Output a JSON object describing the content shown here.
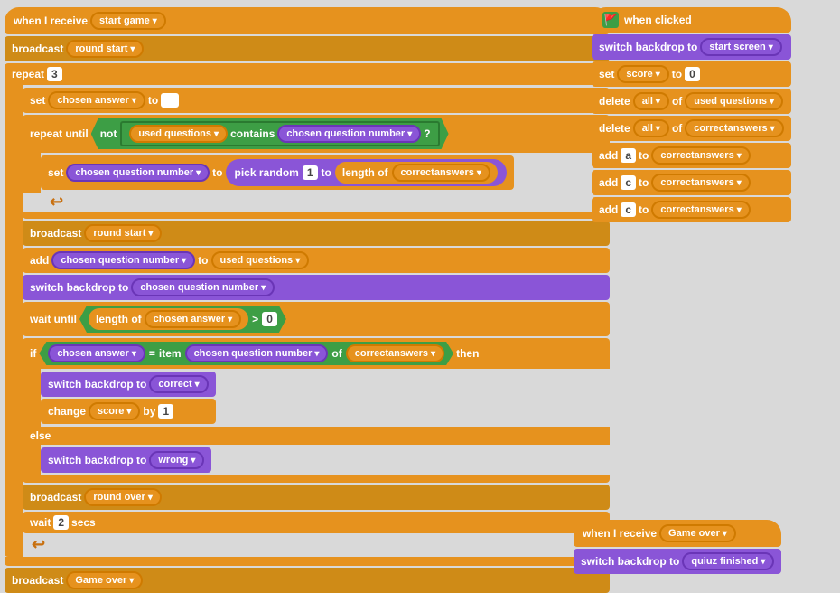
{
  "left": {
    "block1": {
      "hat": "when I receive",
      "receive_val": "start game"
    },
    "block2": {
      "label": "broadcast",
      "val": "round start"
    },
    "block3": {
      "label": "repeat",
      "val": "3"
    },
    "set1": {
      "label": "set",
      "var": "chosen answer",
      "to": "to"
    },
    "repeat_until": {
      "label": "repeat until",
      "not_label": "not",
      "list": "used questions",
      "contains": "contains",
      "var": "chosen question number",
      "q": "?"
    },
    "set2": {
      "label": "set",
      "var": "chosen question number",
      "to": "to",
      "pick": "pick random",
      "n1": "1",
      "to2": "to",
      "length": "length of",
      "list": "correctanswers"
    },
    "broadcast2": {
      "label": "broadcast",
      "val": "round start"
    },
    "add1": {
      "label": "add",
      "var": "chosen question number",
      "to": "to",
      "list": "used questions"
    },
    "switch1": {
      "label": "switch backdrop to",
      "val": "chosen question number"
    },
    "wait_until": {
      "label": "wait until",
      "length": "length of",
      "var": "chosen answer",
      "op": ">",
      "val": "0"
    },
    "if_block": {
      "label": "if",
      "var1": "chosen answer",
      "eq": "=",
      "item": "item",
      "var2": "chosen question number",
      "of": "of",
      "list": "correctanswers",
      "then": "then"
    },
    "switch2": {
      "label": "switch backdrop to",
      "val": "correct"
    },
    "change1": {
      "label": "change",
      "var": "score",
      "by": "by",
      "val": "1"
    },
    "else_label": "else",
    "switch3": {
      "label": "switch backdrop to",
      "val": "wrong"
    },
    "broadcast3": {
      "label": "broadcast",
      "val": "round over"
    },
    "wait1": {
      "label": "wait",
      "val": "2",
      "secs": "secs"
    },
    "broadcast4": {
      "label": "broadcast",
      "val": "Game over"
    }
  },
  "right": {
    "hat": "when clicked",
    "switch1": {
      "label": "switch backdrop to",
      "val": "start screen"
    },
    "set1": {
      "label": "set",
      "var": "score",
      "to": "to",
      "val": "0"
    },
    "delete1": {
      "label": "delete",
      "qty": "all",
      "of": "of",
      "list": "used questions"
    },
    "delete2": {
      "label": "delete",
      "qty": "all",
      "of": "of",
      "list": "correctanswers"
    },
    "add1": {
      "label": "add",
      "val": "a",
      "to": "to",
      "list": "correctanswers"
    },
    "add2": {
      "label": "add",
      "val": "c",
      "to": "to",
      "list": "correctanswers"
    },
    "add3": {
      "label": "add",
      "val": "c",
      "to": "to",
      "list": "correctanswers"
    }
  },
  "bottom_right": {
    "hat": "when I receive",
    "receive_val": "Game over",
    "switch1": {
      "label": "switch backdrop to",
      "val": "quiuz finished"
    }
  }
}
